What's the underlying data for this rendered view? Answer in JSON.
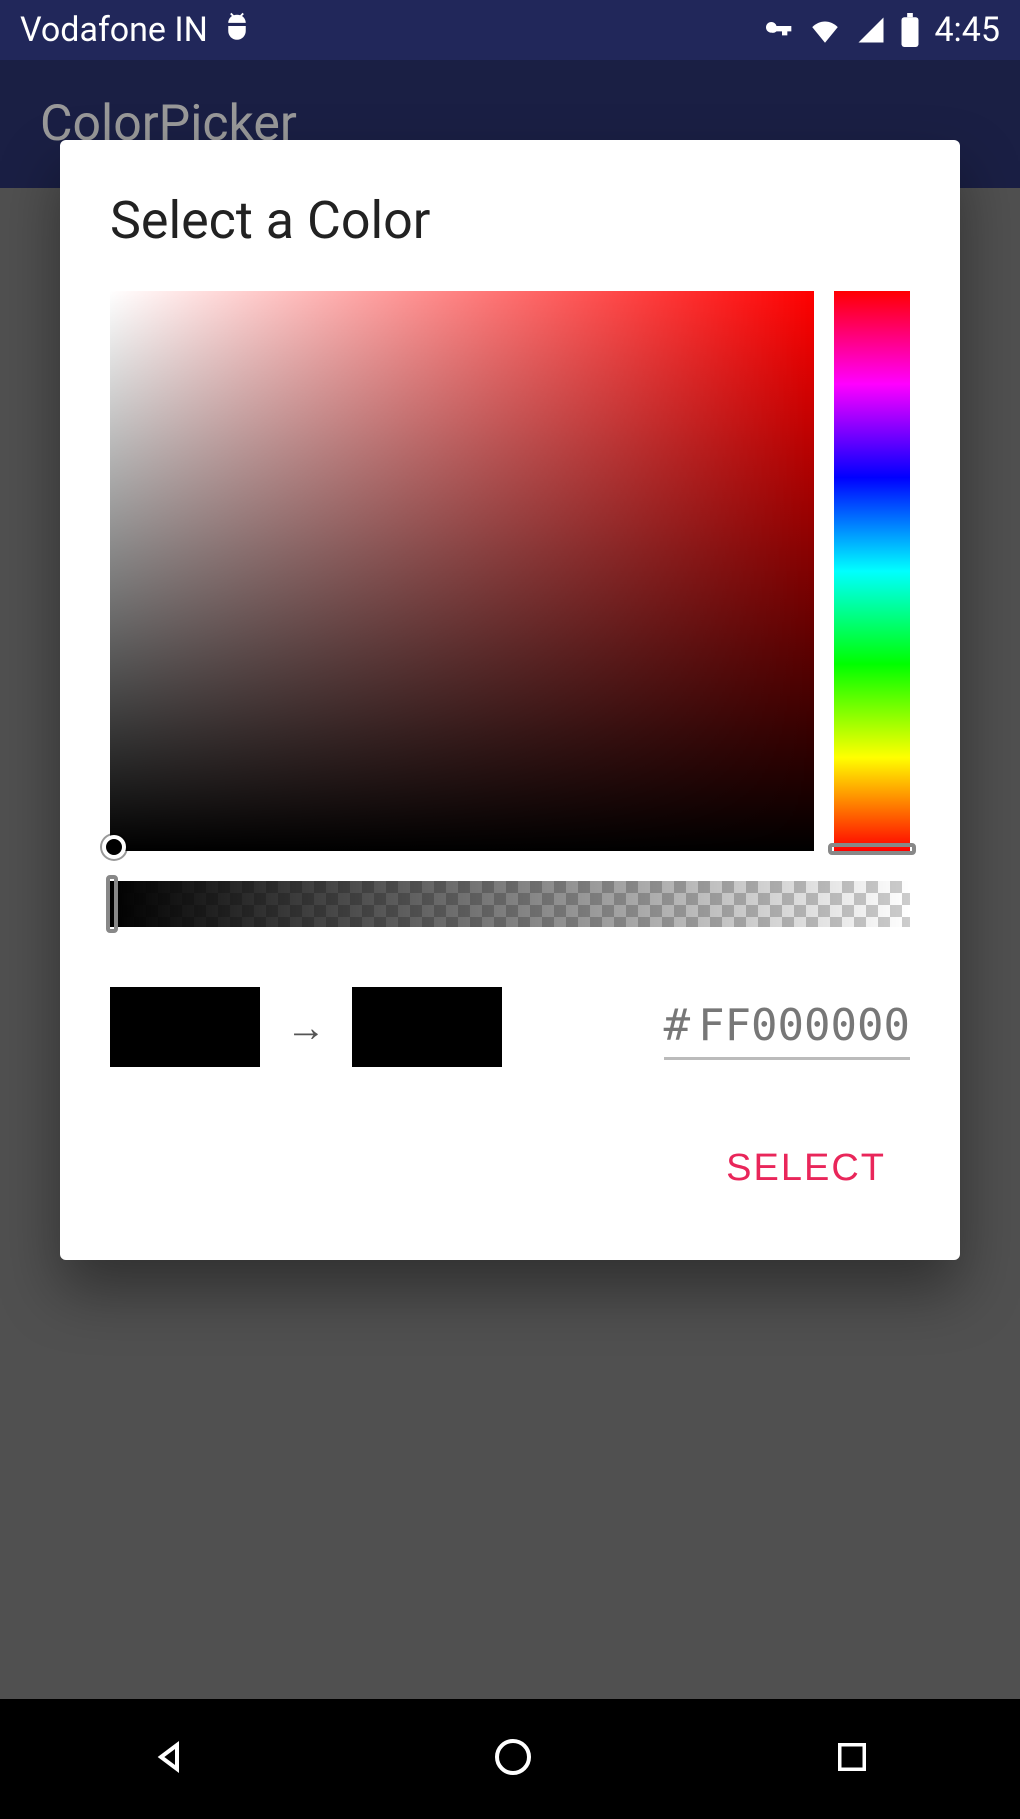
{
  "status_bar": {
    "carrier": "Vodafone IN",
    "time": "4:45",
    "icons": {
      "debug": "adb-icon",
      "vpn": "key-icon",
      "wifi": "wifi-icon",
      "signal": "cell-icon",
      "battery": "battery-icon"
    }
  },
  "app_bar": {
    "title": "ColorPicker"
  },
  "dialog": {
    "title": "Select a Color",
    "hue": 0,
    "saturation": 0,
    "value": 0,
    "alpha": 1.0,
    "old_color": "#000000",
    "new_color": "#000000",
    "hex_prefix": "#",
    "hex_value": "FF000000",
    "arrow_glyph": "→",
    "select_label": "SELECT"
  },
  "nav": {
    "back": "back-icon",
    "home": "home-icon",
    "recent": "recent-icon"
  }
}
